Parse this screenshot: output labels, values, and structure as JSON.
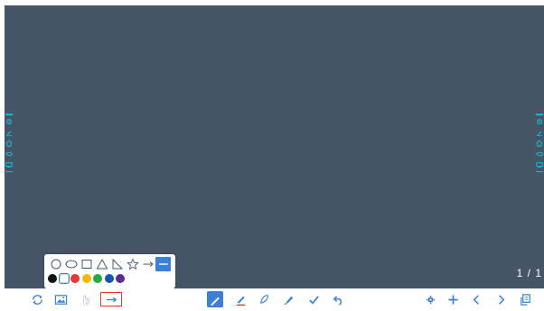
{
  "board": {
    "background": "#465467",
    "page_indicator": "1 / 1"
  },
  "side_rails": {
    "accent": "#17b8d8",
    "icons": [
      "settings-icon",
      "pen-icon",
      "home-icon",
      "undo-icon",
      "toolbox-icon"
    ]
  },
  "shape_popup": {
    "shapes": [
      "circle",
      "ellipse",
      "rectangle",
      "triangle",
      "right-triangle",
      "star",
      "arrow",
      "line"
    ],
    "selected_shape": "line",
    "colors": [
      "#111111",
      "#ffffff",
      "#e53935",
      "#f5b800",
      "#27a844",
      "#1557b0",
      "#5a2d91"
    ],
    "selected_color": "#ffffff"
  },
  "toolbar": {
    "left": [
      "sync-icon",
      "image-icon",
      "pointer-hand-icon",
      "arrow-shape-icon"
    ],
    "center": [
      "pen-icon",
      "highlighter-icon",
      "eraser-icon",
      "brush-icon",
      "check-icon",
      "undo-icon"
    ],
    "right": [
      "settings-icon",
      "add-page-icon",
      "previous-page-icon",
      "next-page-icon",
      "pages-icon"
    ],
    "accent": "#3b7fd6"
  }
}
